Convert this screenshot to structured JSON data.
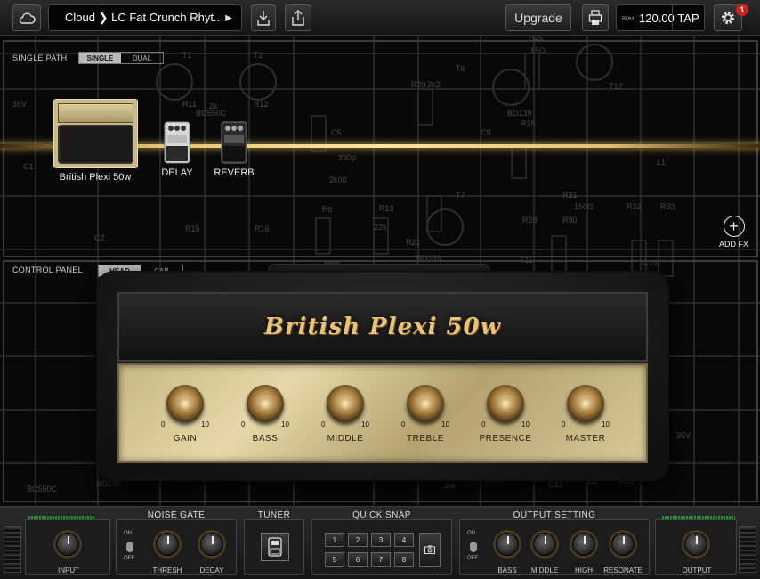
{
  "topbar": {
    "cloud_icon": "cloud-icon",
    "preset_name": "Cloud ❯ LC Fat Crunch Rhyt...",
    "download_icon": "download-icon",
    "share_icon": "share-icon",
    "upgrade_label": "Upgrade",
    "print_icon": "print-icon",
    "bpm_label": "BPM",
    "bpm_value": "120.00",
    "tap_label": "TAP",
    "settings_icon": "gear-icon",
    "notification_count": "1"
  },
  "chain": {
    "label": "SINGLE PATH",
    "modes": [
      "SINGLE",
      "DUAL"
    ],
    "active_mode": "SINGLE",
    "items": [
      {
        "label": "British Plexi 50w"
      },
      {
        "label": "DELAY"
      },
      {
        "label": "REVERB"
      }
    ],
    "add_fx_label": "ADD FX"
  },
  "panel": {
    "label": "CONTROL PANEL",
    "modes": [
      "HEAD",
      "CAB"
    ],
    "active_mode": "HEAD"
  },
  "amp": {
    "title": "British Plexi 50w",
    "scale_min": "0",
    "scale_max": "10",
    "knobs": [
      "GAIN",
      "BASS",
      "MIDDLE",
      "TREBLE",
      "PRESENCE",
      "MASTER"
    ]
  },
  "bottom": {
    "input_label": "INPUT",
    "noise_gate": {
      "title": "NOISE GATE",
      "on": "ON",
      "off": "OFF",
      "knobs": [
        "THRESH",
        "DECAY"
      ]
    },
    "tuner": {
      "title": "TUNER"
    },
    "quick_snap": {
      "title": "QUICK SNAP",
      "buttons": [
        "1",
        "2",
        "3",
        "4",
        "5",
        "6",
        "7",
        "8"
      ]
    },
    "output_setting": {
      "title": "OUTPUT SETTING",
      "on": "ON",
      "off": "OFF",
      "knobs": [
        "BASS",
        "MIDDLE",
        "HIGH",
        "RESONATE"
      ]
    },
    "output_label": "OUTPUT"
  },
  "schematic_labels": [
    "35V",
    "BC550C",
    "2x",
    "R11",
    "R12",
    "T1",
    "T2",
    "T6",
    "T12",
    "R26",
    "15Ω",
    "2k2",
    "R20",
    "BD139",
    "C5",
    "330p",
    "2k00",
    "R6",
    "R19",
    "22k",
    "R21",
    "R25",
    "R28",
    "R30",
    "R31",
    "150Ω",
    "R32",
    "R33",
    "L1",
    "C2",
    "R15",
    "R16",
    "C1",
    "BC550C",
    "BD140",
    "BD139",
    "C9",
    "C10",
    "C13",
    "D4",
    "D6",
    "Re1",
    "T7",
    "T11",
    "35V"
  ]
}
